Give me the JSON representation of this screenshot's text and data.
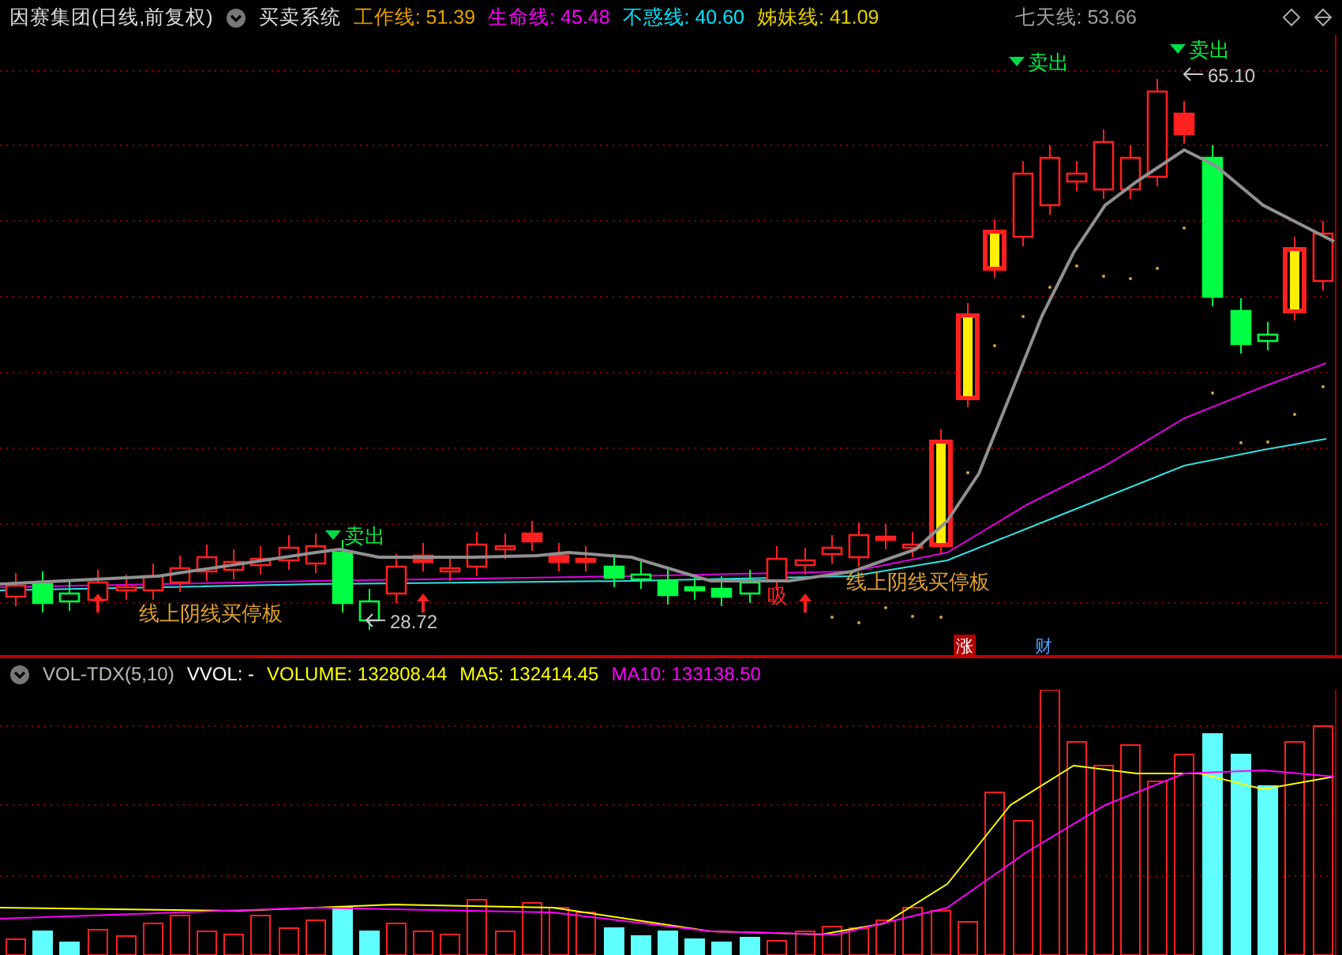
{
  "header": {
    "stock": "因赛集团(日线,前复权)",
    "system": "买卖系统",
    "indicators": [
      {
        "label": "工作线: 51.39",
        "color": "#e8a000"
      },
      {
        "label": "生命线: 45.48",
        "color": "#ff00ff"
      },
      {
        "label": "不惑线: 40.60",
        "color": "#00e5ff"
      },
      {
        "label": "姊妹线: 41.09",
        "color": "#e8d000"
      },
      {
        "label": "七天线: 53.66",
        "color": "#a0a0a0"
      }
    ]
  },
  "main_chart": {
    "sell_signals": [
      "卖出",
      "卖出",
      "卖出"
    ],
    "price_labels": [
      "28.72",
      "65.10"
    ],
    "patterns": [
      "线上阴线买停板",
      "线上阴线买停板"
    ],
    "buy_mark": "吸",
    "badges": [
      {
        "text": "涨",
        "kind": "rise"
      },
      {
        "text": "财",
        "kind": "finance"
      }
    ]
  },
  "volume_pane": {
    "name": "VOL-TDX(5,10)",
    "values": [
      {
        "label": "VVOL: -",
        "color": "#ffffff"
      },
      {
        "label": "VOLUME: 132808.44",
        "color": "#ffff00"
      },
      {
        "label": "MA5: 132414.45",
        "color": "#ffff00"
      },
      {
        "label": "MA10: 133138.50",
        "color": "#ff00ff"
      }
    ]
  }
}
